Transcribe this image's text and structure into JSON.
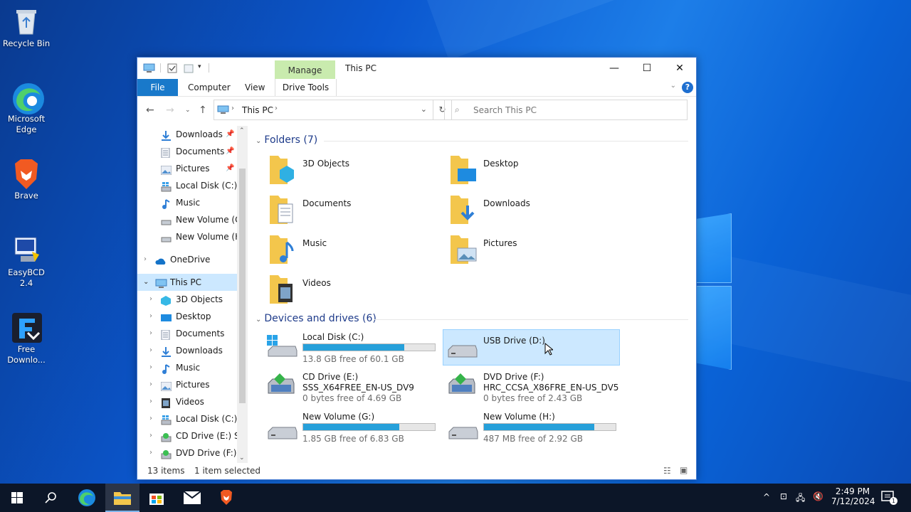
{
  "desktop": {
    "icons": [
      {
        "label": "Recycle Bin",
        "icon": "recycle-bin-icon"
      },
      {
        "label": "Microsoft Edge",
        "icon": "edge-icon"
      },
      {
        "label": "Brave",
        "icon": "brave-icon"
      },
      {
        "label": "EasyBCD 2.4",
        "icon": "easybcd-icon"
      },
      {
        "label": "Free Downlo...",
        "icon": "free-download-manager-icon"
      }
    ]
  },
  "window": {
    "title": "This PC",
    "manage_tab": "Manage",
    "ribbon_tabs": [
      "File",
      "Computer",
      "View",
      "Drive Tools"
    ],
    "address": {
      "segment": "This PC"
    },
    "search": {
      "placeholder": "Search This PC"
    }
  },
  "navpane": {
    "quick": [
      {
        "label": "Downloads",
        "icon": "downloads-icon",
        "pinned": true
      },
      {
        "label": "Documents",
        "icon": "documents-icon",
        "pinned": true
      },
      {
        "label": "Pictures",
        "icon": "pictures-icon",
        "pinned": true
      },
      {
        "label": "Local Disk (C:)",
        "icon": "local-disk-icon",
        "pinned": false
      },
      {
        "label": "Music",
        "icon": "music-icon",
        "pinned": false
      },
      {
        "label": "New Volume (G:",
        "icon": "drive-icon",
        "pinned": false
      },
      {
        "label": "New Volume (H:",
        "icon": "drive-icon",
        "pinned": false
      }
    ],
    "onedrive": "OneDrive",
    "thispc": "This PC",
    "pc_children": [
      {
        "label": "3D Objects",
        "icon": "3d-objects-icon"
      },
      {
        "label": "Desktop",
        "icon": "desktop-icon"
      },
      {
        "label": "Documents",
        "icon": "documents-icon"
      },
      {
        "label": "Downloads",
        "icon": "downloads-icon"
      },
      {
        "label": "Music",
        "icon": "music-icon"
      },
      {
        "label": "Pictures",
        "icon": "pictures-icon"
      },
      {
        "label": "Videos",
        "icon": "videos-icon"
      },
      {
        "label": "Local Disk (C:)",
        "icon": "local-disk-icon"
      },
      {
        "label": "CD Drive (E:) SSS",
        "icon": "cd-drive-icon"
      },
      {
        "label": "DVD Drive (F:) H",
        "icon": "dvd-drive-icon"
      }
    ]
  },
  "content": {
    "folders_header": "Folders (7)",
    "folders": [
      {
        "label": "3D Objects",
        "icon": "3d-objects-folder-icon"
      },
      {
        "label": "Desktop",
        "icon": "desktop-folder-icon"
      },
      {
        "label": "Documents",
        "icon": "documents-folder-icon"
      },
      {
        "label": "Downloads",
        "icon": "downloads-folder-icon"
      },
      {
        "label": "Music",
        "icon": "music-folder-icon"
      },
      {
        "label": "Pictures",
        "icon": "pictures-folder-icon"
      },
      {
        "label": "Videos",
        "icon": "videos-folder-icon"
      }
    ],
    "drives_header": "Devices and drives (6)",
    "drives": {
      "c": {
        "name": "Local Disk (C:)",
        "free": "13.8 GB free of 60.1 GB",
        "used_fraction": 0.77
      },
      "d": {
        "name": "USB Drive (D:)"
      },
      "e": {
        "name": "CD Drive (E:)",
        "label": "SSS_X64FREE_EN-US_DV9",
        "free": "0 bytes free of 4.69 GB"
      },
      "f": {
        "name": "DVD Drive (F:)",
        "label": "HRC_CCSA_X86FRE_EN-US_DV5",
        "free": "0 bytes free of 2.43 GB"
      },
      "g": {
        "name": "New Volume (G:)",
        "free": "1.85 GB free of 6.83 GB",
        "used_fraction": 0.73
      },
      "h": {
        "name": "New Volume (H:)",
        "free": "487 MB free of 2.92 GB",
        "used_fraction": 0.84
      }
    }
  },
  "status": {
    "items": "13 items",
    "selected": "1 item selected"
  },
  "taskbar": {
    "time": "2:49 PM",
    "date": "7/12/2024",
    "notification_count": "1"
  }
}
